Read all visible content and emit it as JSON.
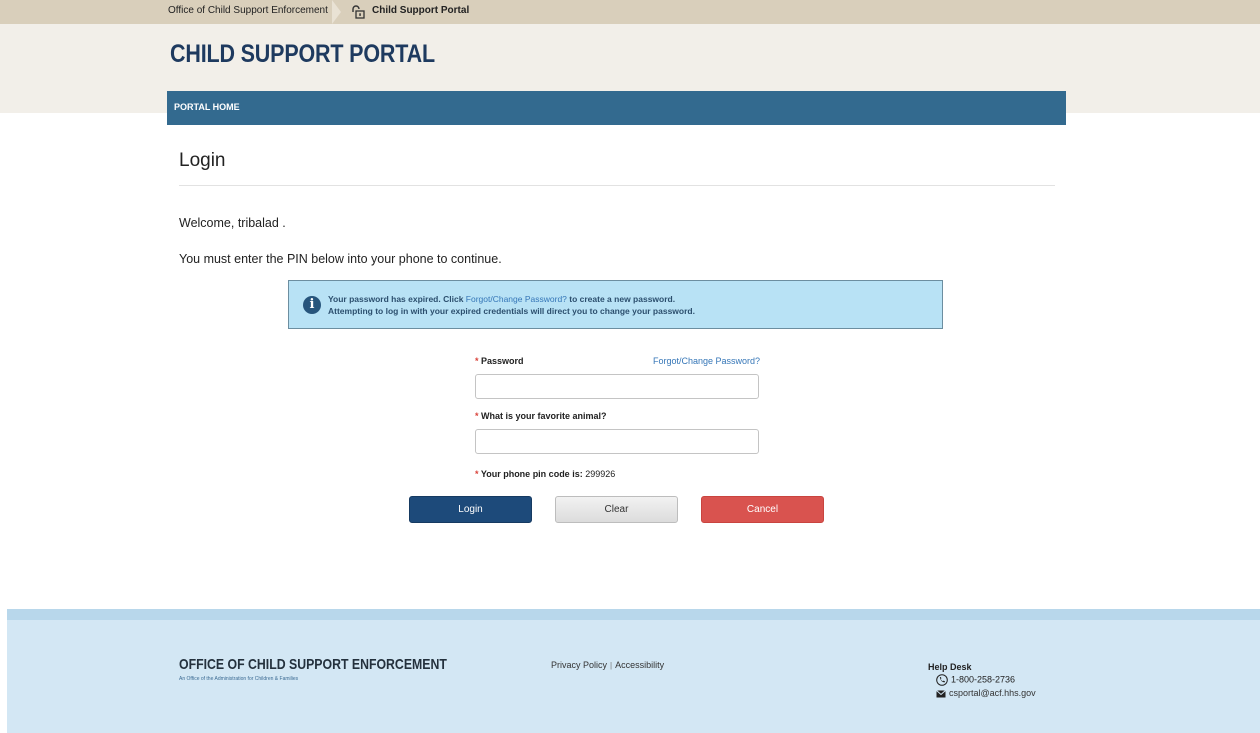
{
  "breadcrumb": {
    "items": [
      "Office of Child Support Enforcement",
      "Child Support Portal"
    ]
  },
  "header": {
    "title": "CHILD SUPPORT PORTAL"
  },
  "nav": {
    "items": [
      "PORTAL HOME"
    ]
  },
  "page": {
    "heading": "Login",
    "welcome": "Welcome, tribalad .",
    "instruction": "You must enter the PIN below into your phone to continue."
  },
  "alert": {
    "line1_prefix": "Your password has expired. Click ",
    "line1_link": "Forgot/Change Password?",
    "line1_suffix": " to create a new password.",
    "line2": "Attempting to log in with your expired credentials will direct you to change your password.",
    "icon": "info-icon"
  },
  "form": {
    "required_marker": "*",
    "password_label": "Password",
    "forgot_link": "Forgot/Change Password?",
    "password_value": "",
    "security_question_label": "What is your favorite animal?",
    "security_answer_value": "",
    "pin_label": "Your phone pin code is:",
    "pin_value": "299926"
  },
  "buttons": {
    "login": "Login",
    "clear": "Clear",
    "cancel": "Cancel"
  },
  "footer": {
    "logo_title": "OFFICE OF CHILD SUPPORT ENFORCEMENT",
    "logo_subtitle": "An Office of the Administration for Children & Families",
    "links": [
      "Privacy Policy",
      "Accessibility"
    ],
    "link_separator": "|",
    "help_title": "Help Desk",
    "help_phone": "1-800-258-2736",
    "help_email": "csportal@acf.hhs.gov"
  },
  "colors": {
    "nav": "#336a8f",
    "login_button": "#1d4a7a",
    "cancel_button": "#d9534f",
    "alert_background": "#b8e2f5",
    "footer_background": "#d3e7f4"
  }
}
